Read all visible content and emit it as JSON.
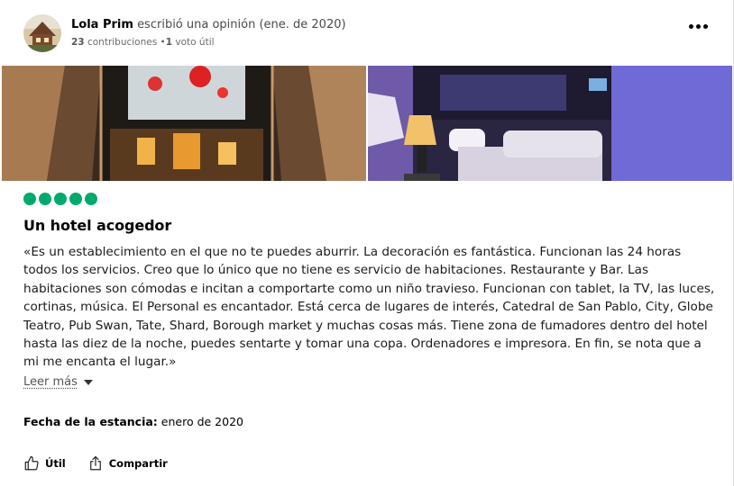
{
  "review": {
    "author_name": "Lola Prim",
    "action_text": "escribió una opinión (ene. de 2020)",
    "contributions_count": "23",
    "contributions_label": "contribuciones",
    "separator": "•",
    "helpful_count": "1",
    "helpful_label": "voto útil",
    "rating": {
      "bubbles": 5,
      "max": 5,
      "color": "#00aa6c"
    },
    "title": "Un hotel acogedor",
    "body": "«Es un establecimiento en el que no te puedes aburrir. La decoración es fantástica. Funcionan las 24 horas todos los servicios. Creo que lo único que no tiene es servicio de habitaciones. Restaurante y Bar. Las habitaciones son cómodas e incitan a comportarte como un niño travieso. Funcionan con tablet, la TV, las luces, cortinas, música. El Personal es encantador. Está cerca de lugares de interés, Catedral de San Pablo, City, Globe Teatro, Pub Swan, Tate, Shard, Borough market y muchas cosas más. Tiene zona de fumadores dentro del hotel hasta las diez de la noche, puedes sentarte y tomar una copa. Ordenadores e impresora. En fin, se nota que a mi me encanta el lugar.»",
    "read_more": "Leer más",
    "stay_label": "Fecha de la estancia:",
    "stay_value": "enero de 2020"
  },
  "actions": {
    "helpful_label": "Útil",
    "share_label": "Compartir"
  },
  "icons": {
    "more": "more-options-icon",
    "thumbs_up": "thumbs-up-icon",
    "share": "share-icon",
    "dropdown": "chevron-down-icon"
  }
}
